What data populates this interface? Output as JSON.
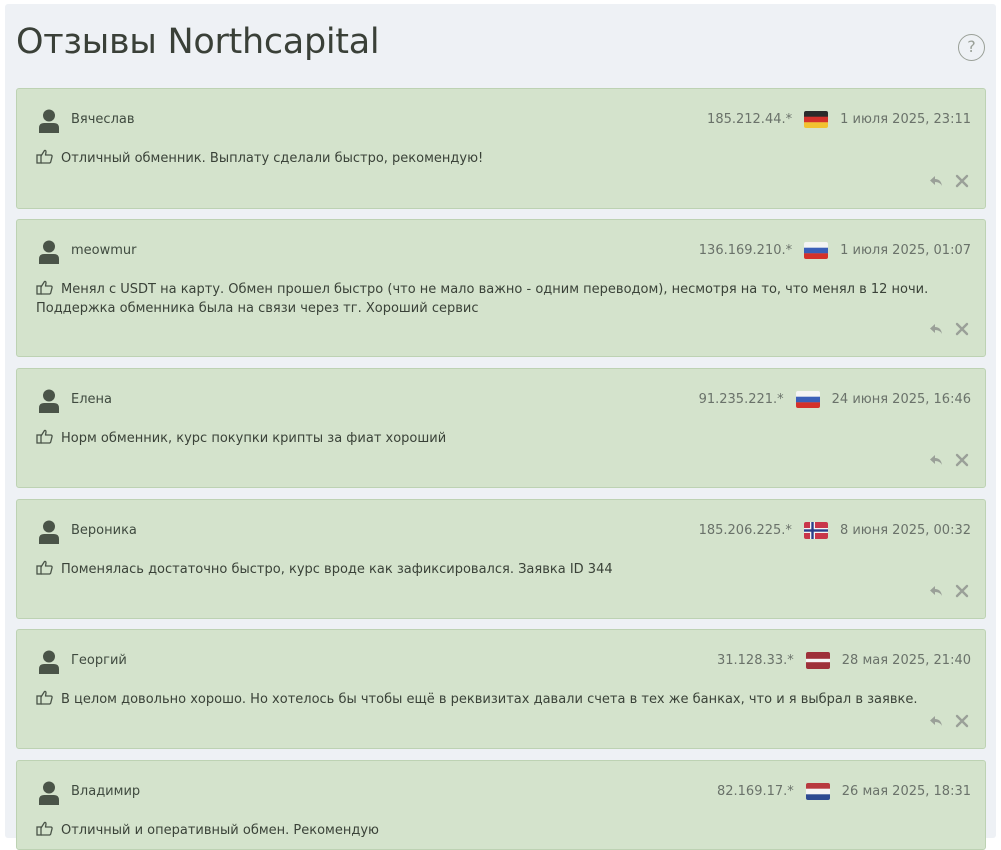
{
  "page": {
    "title": "Отзывы Northcapital",
    "help_label": "?"
  },
  "colors": {
    "card_bg": "#d4e3cc",
    "card_border": "#bdd2b3",
    "page_bg": "#eef1f5",
    "icon_gray": "#9aa098"
  },
  "reviews": [
    {
      "author": "Вячеслав",
      "ip": "185.212.44.*",
      "flag": "germany-flag",
      "date": "1 июля 2025, 23:11",
      "text": "Отличный обменник. Выплату сделали быстро, рекомендую!"
    },
    {
      "author": "meowmur",
      "ip": "136.169.210.*",
      "flag": "russia-flag",
      "date": "1 июля 2025, 01:07",
      "text": "Менял с USDT на карту. Обмен прошел быстро (что не мало важно - одним переводом), несмотря на то, что менял в 12 ночи. Поддержка обменника была на связи через тг. Хороший сервис"
    },
    {
      "author": "Елена",
      "ip": "91.235.221.*",
      "flag": "russia-flag",
      "date": "24 июня 2025, 16:46",
      "text": "Норм обменник, курс покупки крипты за фиат хороший"
    },
    {
      "author": "Вероника",
      "ip": "185.206.225.*",
      "flag": "norway-flag",
      "date": "8 июня 2025, 00:32",
      "text": "Поменялась достаточно быстро, курс вроде как зафиксировался. Заявка ID 344"
    },
    {
      "author": "Георгий",
      "ip": "31.128.33.*",
      "flag": "latvia-flag",
      "date": "28 мая 2025, 21:40",
      "text": "В целом довольно хорошо. Но хотелось бы чтобы ещё в реквизитах давали счета в тех же банках, что и я выбрал в заявке."
    },
    {
      "author": "Владимир",
      "ip": "82.169.17.*",
      "flag": "netherlands-flag",
      "date": "26 мая 2025, 18:31",
      "text": "Отличный и оперативный обмен. Рекомендую"
    }
  ]
}
